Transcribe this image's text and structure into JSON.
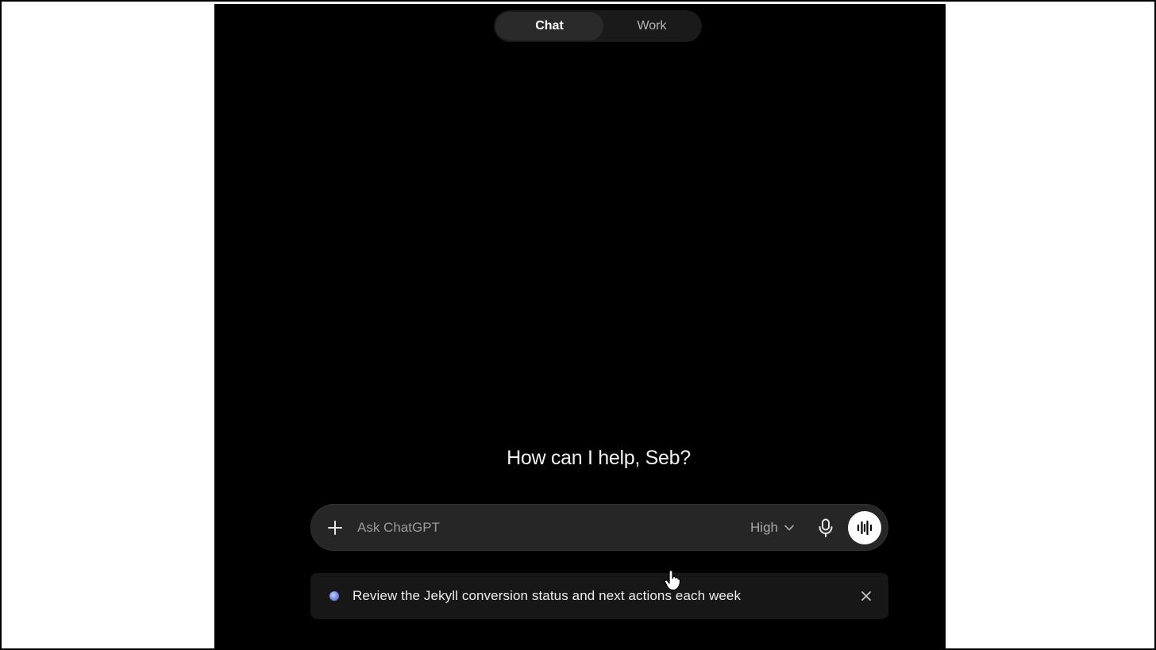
{
  "tabs": [
    {
      "label": "Chat",
      "active": true
    },
    {
      "label": "Work",
      "active": false
    }
  ],
  "greeting": "How can I help, Seb?",
  "composer": {
    "placeholder": "Ask ChatGPT",
    "value": "",
    "effort_label": "High",
    "icons": {
      "add": "plus-icon",
      "dropdown": "chevron-down-icon",
      "mic": "microphone-icon",
      "voice": "voice-waveform-icon"
    }
  },
  "suggestion": {
    "text": "Review the Jekyll conversion status and next actions each week",
    "icon": "suggestion-orb-icon",
    "close_icon": "close-icon"
  },
  "colors": {
    "app_background": "#000000",
    "composer_background": "#262626",
    "suggestion_background": "#171717",
    "voice_button": "#ffffff"
  }
}
